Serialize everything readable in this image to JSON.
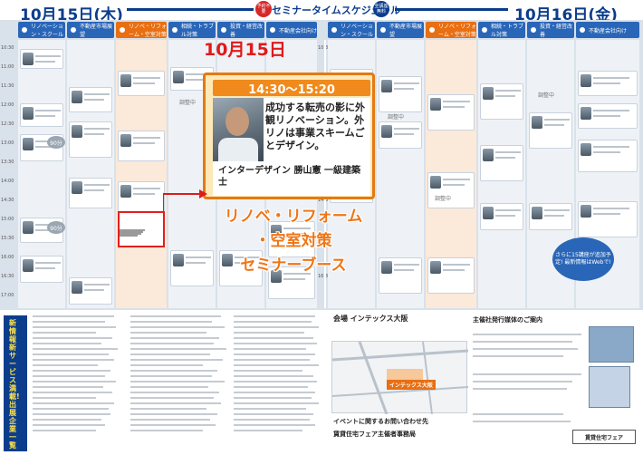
{
  "header": {
    "day1": "10月15日(木)",
    "day2": "10月16日(金)",
    "schedule_title": "セミナータイムスケジュール",
    "badge_left": "予約不要",
    "badge_right": "全講座無料"
  },
  "columns": {
    "day1": [
      {
        "label": "リノベーション・スクール"
      },
      {
        "label": "不動産市場展望"
      },
      {
        "label": "リノベ・リフォーム・空室対策"
      },
      {
        "label": "相続・トラブル対策"
      },
      {
        "label": "投資・経営改善"
      },
      {
        "label": "不動産会社向け"
      }
    ],
    "day2": [
      {
        "label": "リノベーション・スクール"
      },
      {
        "label": "不動産市場展望"
      },
      {
        "label": "リノベ・リフォーム・空室対策"
      },
      {
        "label": "相続・トラブル対策"
      },
      {
        "label": "投資・経営改善"
      },
      {
        "label": "不動産会社向け"
      }
    ]
  },
  "times": [
    "10:30",
    "11:00",
    "11:30",
    "12:00",
    "12:30",
    "13:00",
    "13:30",
    "14:00",
    "14:30",
    "15:00",
    "15:30",
    "16:00",
    "16:30",
    "17:00"
  ],
  "adjust_label": "調整中",
  "popup": {
    "date_label": "10月15日",
    "time": "14:30～15:20",
    "title": "成功する転売の影に外観リノベーション。外リノは事業スキームごとデザイン。",
    "speaker": "インターデザイン 勝山憲 一級建築士"
  },
  "callout": {
    "line1": "リノベ・リフォーム",
    "line2": "・空室対策",
    "line3": "セミナーブース"
  },
  "bubble": {
    "text": "さらに15講座が追加予定! 最新情報はWebで!"
  },
  "ninety": "90分",
  "bottom": {
    "vertical": "新情報 新サービス満載! 出展企業一覧",
    "venue": "会場 インテックス大阪",
    "map_tag": "インテックス大阪",
    "event_head": "イベントに関するお問い合わせ先",
    "event_sub": "賃貸住宅フェア主催者事務局",
    "pub_head": "主催社発行媒体のご案内",
    "footer_logo": "賃貸住宅フェア"
  }
}
